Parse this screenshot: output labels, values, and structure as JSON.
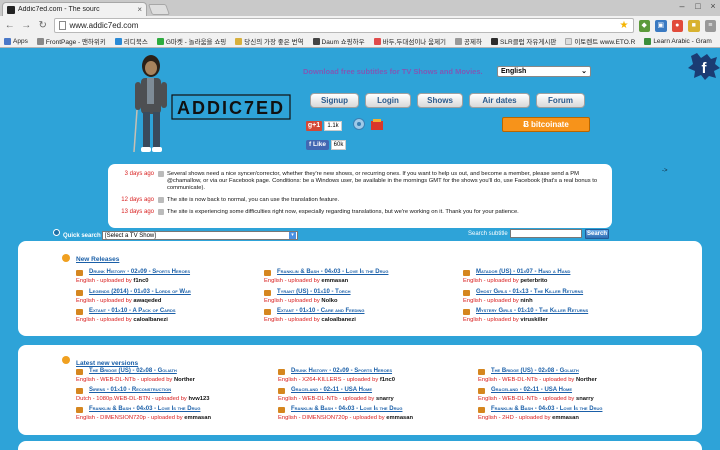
{
  "browser": {
    "tab_title": "Addic7ed.com - The sourc",
    "url": "www.addic7ed.com",
    "bookmarks": [
      {
        "label": "Apps",
        "color": "#4a78c8"
      },
      {
        "label": "FrontPage - 맨하위키",
        "color": "#888888"
      },
      {
        "label": "리디북스",
        "color": "#2a8ad6"
      },
      {
        "label": "G마켓 - 놀라움을 쇼핑",
        "color": "#2dab3f"
      },
      {
        "label": "당신의 가장 좋은 번역",
        "color": "#d8b03c"
      },
      {
        "label": "Daum 쇼핑하우",
        "color": "#444444"
      },
      {
        "label": "바두,두대섬이나 움제기",
        "color": "#e04b4b"
      },
      {
        "label": "공제하",
        "color": "#999999"
      },
      {
        "label": "SLR클럽 자유게시판",
        "color": "#2d2d2d"
      },
      {
        "label": "이토렌트 www.ETO.R",
        "color": "#eeeeee"
      },
      {
        "label": "Learn Arabic - Gram",
        "color": "#3b8d3b"
      }
    ]
  },
  "header": {
    "logo_text": "ADDIC7ED",
    "tagline": "Download free subtitles for TV Shows and Movies.",
    "language": "English",
    "nav": [
      "Signup",
      "Login",
      "Shows",
      "Air dates",
      "Forum"
    ],
    "gplus_label": "g+1",
    "gplus_count": "1.1k",
    "fb_like_label": "Like",
    "fb_count": "60k",
    "bitcoin_label": "bitcoinate",
    "corner_mark": "->"
  },
  "news": [
    {
      "date": "3 days ago",
      "text": "Several shows need a nice syncer/corrector, whether they're new shows, or recurring ones. If you want to help us out, and become a member, please send a PM @chamallow, or via our Facebook page. Conditions: be a Windows user, be available in the mornings GMT for the shows you'll do, use Facebook (that's a real bonus to communicate)."
    },
    {
      "date": "12 days ago",
      "text": "The site is now back to normal, you can use the translation feature."
    },
    {
      "date": "13 days ago",
      "text": "The site is experiencing some difficulties right now, especially regarding translations, but we're working on it. Thank you for your patience."
    }
  ],
  "search": {
    "label": "Quick search",
    "select_value": "[Select a TV Show]",
    "subtitle_label": "Search subtitle",
    "button": "Search"
  },
  "new_releases": {
    "title": "New Releases",
    "items": [
      {
        "title": "Drunk History - 02x09 - Sports Heroes",
        "lang": "English - uploaded by",
        "user": "f1nc0"
      },
      {
        "title": "Franklin & Bash - 04x03 - Love Is the Drug",
        "lang": "English - uploaded by",
        "user": "emmasan"
      },
      {
        "title": "Matador (US) - 01x07 - Hand a Hand",
        "lang": "English - uploaded by",
        "user": "peterbrito"
      },
      {
        "title": "Legends (2014) - 01x03 - Lords of War",
        "lang": "English - uploaded by",
        "user": "awaqeded"
      },
      {
        "title": "Tyrant (US) - 01x10 - Torch",
        "lang": "English - uploaded by",
        "user": "Nolko"
      },
      {
        "title": "Ghost Girls - 01x13 - The Killer Returns",
        "lang": "English - uploaded by",
        "user": "ninh"
      },
      {
        "title": "Extant - 01x10 - A Pack of Cards",
        "lang": "English - uploaded by",
        "user": "caloalbanezi"
      },
      {
        "title": "Extant - 01x10 - Care and Feeding",
        "lang": "English - uploaded by",
        "user": "caloalbanezi"
      },
      {
        "title": "Mystery Girls - 01x10 - The Killer Returns",
        "lang": "English - uploaded by",
        "user": "viruskiller"
      }
    ]
  },
  "latest_versions": {
    "title": "Latest new versions",
    "items": [
      {
        "title": "The Bridge (US) - 02x08 - Goliath",
        "lang": "English - WEB-DL-NTb - uploaded by",
        "user": "Norther"
      },
      {
        "title": "Drunk History - 02x09 - Sports Heroes",
        "lang": "English - X264-KILLERS - uploaded by",
        "user": "f1nc0"
      },
      {
        "title": "The Bridge (US) - 02x08 - Goliath",
        "lang": "English - WEB-DL-NTb - uploaded by",
        "user": "Norther"
      },
      {
        "title": "Sirens - 01x10 - Reconstruction",
        "lang": "Dutch - 1080p.WEB-DL-BTN - uploaded by",
        "user": "hvw123"
      },
      {
        "title": "Graceland - 02x11 - USA Home",
        "lang": "English - WEB-DL-NTb - uploaded by",
        "user": "snarry"
      },
      {
        "title": "Graceland - 02x11 - USA Home",
        "lang": "English - WEB-DL-NTb - uploaded by",
        "user": "snarry"
      },
      {
        "title": "Franklin & Bash - 04x03 - Love Is the Drug",
        "lang": "English - DIMENSION720p - uploaded by",
        "user": "emmasan"
      },
      {
        "title": "Franklin & Bash - 04x03 - Love Is the Drug",
        "lang": "English - DIMENSION720p - uploaded by",
        "user": "emmasan"
      },
      {
        "title": "Franklin & Bash - 04x03 - Love Is the Drug",
        "lang": "English - 2HD - uploaded by",
        "user": "emmasan"
      }
    ]
  }
}
